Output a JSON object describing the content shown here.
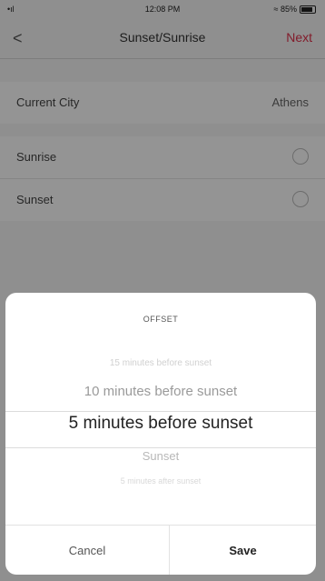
{
  "status_bar": {
    "signal": "•ıl",
    "time": "12:08 PM",
    "battery": "≈ 85%"
  },
  "nav": {
    "title": "Sunset/Sunrise",
    "next_label": "Next",
    "back_glyph": "<"
  },
  "settings": {
    "current_city": {
      "label": "Current City",
      "value": "Athens"
    },
    "sunrise": {
      "label": "Sunrise"
    },
    "sunset": {
      "label": "Sunset"
    }
  },
  "offset_sheet": {
    "title": "OFFSET",
    "options": [
      "15 minutes before sunset",
      "10 minutes before sunset",
      "5 minutes before sunset",
      "Sunset",
      "5 minutes after sunset"
    ],
    "selected_index": 2,
    "cancel_label": "Cancel",
    "save_label": "Save"
  },
  "colors": {
    "accent": "#e0304a",
    "overlay": "rgba(0,0,0,0.42)"
  }
}
